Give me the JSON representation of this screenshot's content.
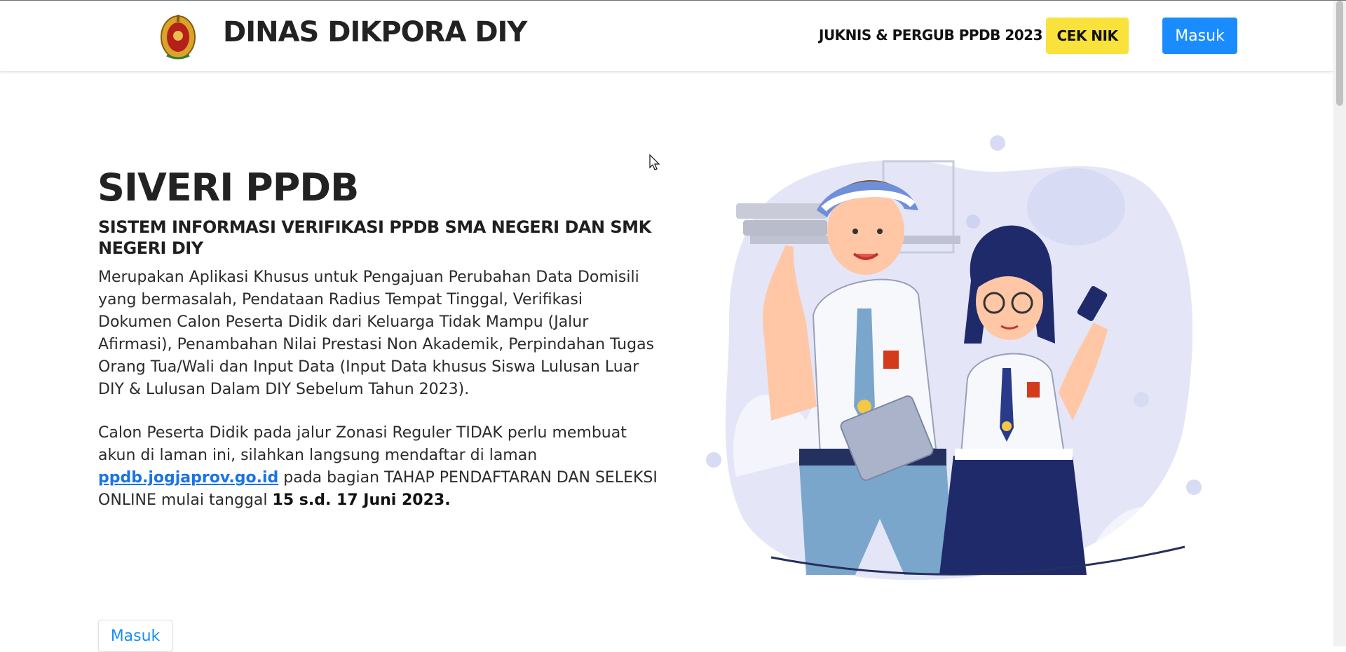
{
  "header": {
    "brand": "DINAS DIKPORA DIY",
    "nav_link": "JUKNIS & PERGUB PPDB 2023",
    "cek_nik_label": "CEK NIK",
    "masuk_label": "Masuk"
  },
  "hero": {
    "title": "SIVERI PPDB",
    "subtitle": "SISTEM INFORMASI VERIFIKASI PPDB SMA NEGERI DAN SMK NEGERI DIY",
    "paragraph1": "Merupakan Aplikasi Khusus untuk Pengajuan Perubahan Data Domisili yang bermasalah, Pendataan Radius Tempat Tinggal, Verifikasi Dokumen Calon Peserta Didik dari Keluarga Tidak Mampu (Jalur Afirmasi), Penambahan Nilai Prestasi Non Akademik, Perpindahan Tugas Orang Tua/Wali dan Input Data (Input Data khusus Siswa Lulusan Luar DIY & Lulusan Dalam DIY Sebelum Tahun 2023).",
    "paragraph2_part1": "Calon Peserta Didik pada jalur Zonasi Reguler TIDAK perlu membuat akun di laman ini, silahkan langsung mendaftar di laman ",
    "paragraph2_link": "ppdb.jogjaprov.go.id",
    "paragraph2_part2": " pada bagian TAHAP PENDAFTARAN DAN SELEKSI ONLINE mulai tanggal ",
    "paragraph2_bold": "15 s.d. 17 Juni 2023.",
    "masuk_button_label": "Masuk"
  },
  "colors": {
    "accent_blue": "#1a8cff",
    "cek_yellow": "#f9e23b",
    "link_blue": "#1a73e8"
  },
  "icons": {
    "logo": "dikpora-crest-logo",
    "cursor": "mouse-pointer-icon"
  }
}
